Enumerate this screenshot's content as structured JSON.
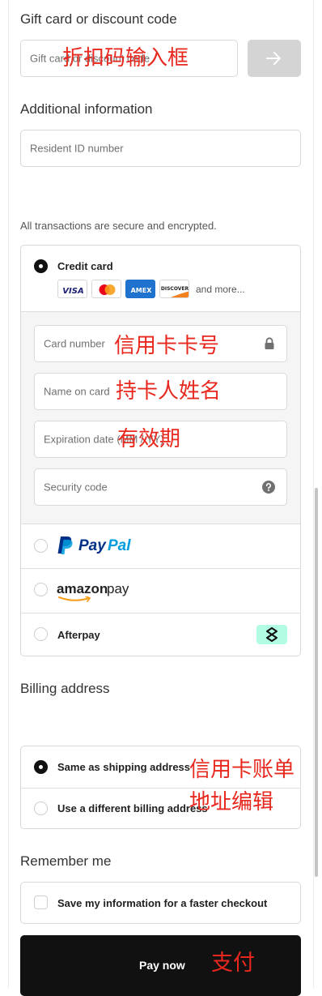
{
  "gift": {
    "heading": "Gift card or discount code",
    "placeholder": "Gift card or discount code",
    "annotation": "折扣码输入框"
  },
  "additional": {
    "heading": "Additional information",
    "placeholder": "Resident ID number"
  },
  "payment": {
    "secure_note": "All transactions are secure and encrypted.",
    "credit_card": {
      "label": "Credit card",
      "more": "and more...",
      "card_number_placeholder": "Card number",
      "card_number_annotation": "信用卡卡号",
      "name_placeholder": "Name on card",
      "name_annotation": "持卡人姓名",
      "expiration_placeholder": "Expiration date (MM / YY)",
      "expiration_annotation": "有效期",
      "security_placeholder": "Security code",
      "logos": [
        "VISA",
        "MASTERCARD",
        "AMEX",
        "DISCOVER"
      ]
    },
    "paypal": {
      "brand_a": "Pay",
      "brand_b": "Pal"
    },
    "amazon": {
      "brand_a": "amazon",
      "brand_b": "pay"
    },
    "afterpay": {
      "label": "Afterpay"
    }
  },
  "billing": {
    "heading": "Billing address",
    "same_label": "Same as shipping address",
    "different_label": "Use a different billing address",
    "annotation_line1": "信用卡账单",
    "annotation_line2": "地址编辑"
  },
  "remember": {
    "heading": "Remember me",
    "save_label": "Save my information for a faster checkout"
  },
  "pay": {
    "label": "Pay now",
    "annotation": "支付"
  },
  "colors": {
    "annotation": "#e8281e",
    "pay_button": "#111111",
    "afterpay_badge": "#b2fce4",
    "paypal_dark": "#003087",
    "paypal_light": "#009cde",
    "amex": "#1f72cd",
    "mastercard_red": "#eb001b",
    "mastercard_orange": "#f79e1b",
    "discover_orange": "#f48120",
    "visa_blue": "#1a1f71"
  }
}
